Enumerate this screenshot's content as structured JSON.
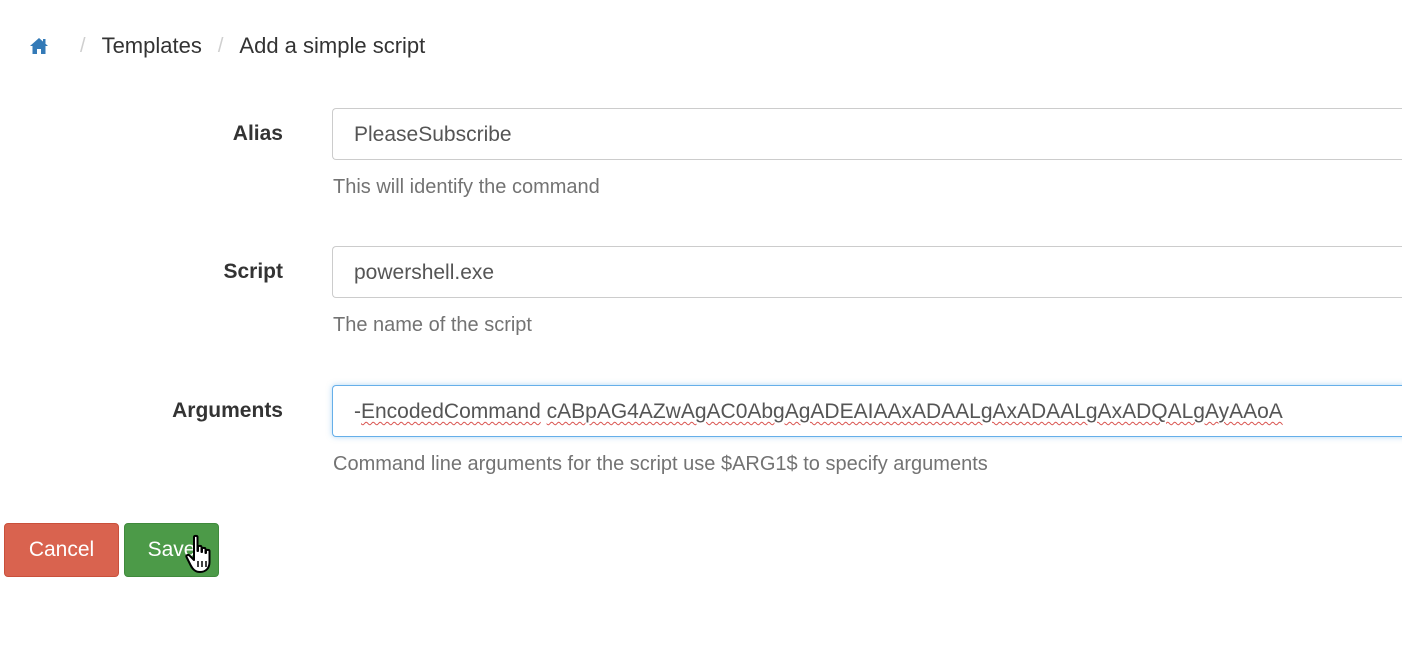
{
  "breadcrumb": {
    "home_icon": "home-icon",
    "items": [
      "Templates",
      "Add a simple script"
    ]
  },
  "form": {
    "alias": {
      "label": "Alias",
      "value": "PleaseSubscribe",
      "help": "This will identify the command"
    },
    "script": {
      "label": "Script",
      "value": "powershell.exe",
      "help": "The name of the script"
    },
    "arguments": {
      "label": "Arguments",
      "value_prefix": "-",
      "value_word1": "EncodedCommand",
      "value_word2": "cABpAG4AZwAgAC0AbgAgADEAIAAxADAALgAxADAALgAxADQALgAyAAoA",
      "help": "Command line arguments for the script use $ARG1$ to specify arguments"
    }
  },
  "buttons": {
    "cancel_label": "Cancel",
    "save_label": "Save"
  },
  "colors": {
    "cancel": "#d9634f",
    "save": "#4c9a48",
    "focus_border": "#66afe9",
    "home_icon": "#337ab7"
  },
  "cursor": "hand-pointer-icon"
}
